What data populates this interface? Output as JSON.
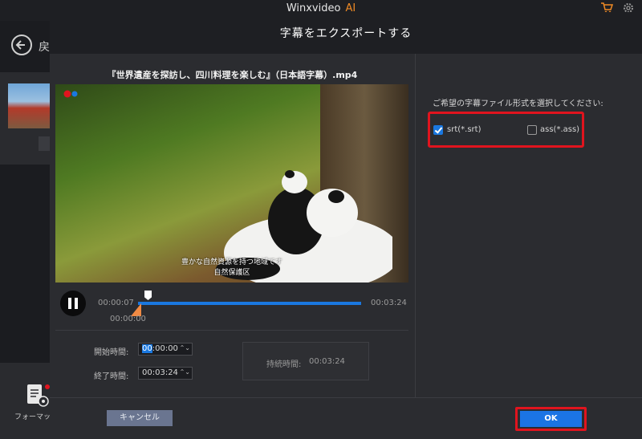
{
  "app": {
    "title": "Winxvideo",
    "title_accent": "AI",
    "back_label": "戻",
    "format_label": "フォーマット",
    "accent_color": "#f08a24"
  },
  "dialog": {
    "title": "字幕をエクスポートする",
    "file_name": "『世界遺産を探訪し、四川料理を楽しむ』（日本語字幕）.mp4",
    "video": {
      "subtitle_line1": "豊かな自然資源を持つ地域です",
      "subtitle_line2": "自然保護区"
    },
    "player": {
      "current_time": "00:00:07",
      "total_time": "00:03:24",
      "start_marker_time": "00:00:00",
      "progress_fraction": 1.0,
      "play_state_icon": "pause-icon"
    },
    "trim": {
      "start_label": "開始時間:",
      "start_value_caret": "00",
      "start_value_rest": ":00:00",
      "end_label": "終了時間:",
      "end_value": "00:03:24",
      "duration_label": "持続時間:",
      "duration_value": "00:03:24"
    },
    "format": {
      "prompt": "ご希望の字幕ファイル形式を選択してください:",
      "options": [
        {
          "label": "srt(*.srt)",
          "checked": true
        },
        {
          "label": "ass(*.ass)",
          "checked": false
        }
      ],
      "highlight_color": "#e0141e"
    },
    "buttons": {
      "cancel": "キャンセル",
      "ok": "OK"
    }
  }
}
